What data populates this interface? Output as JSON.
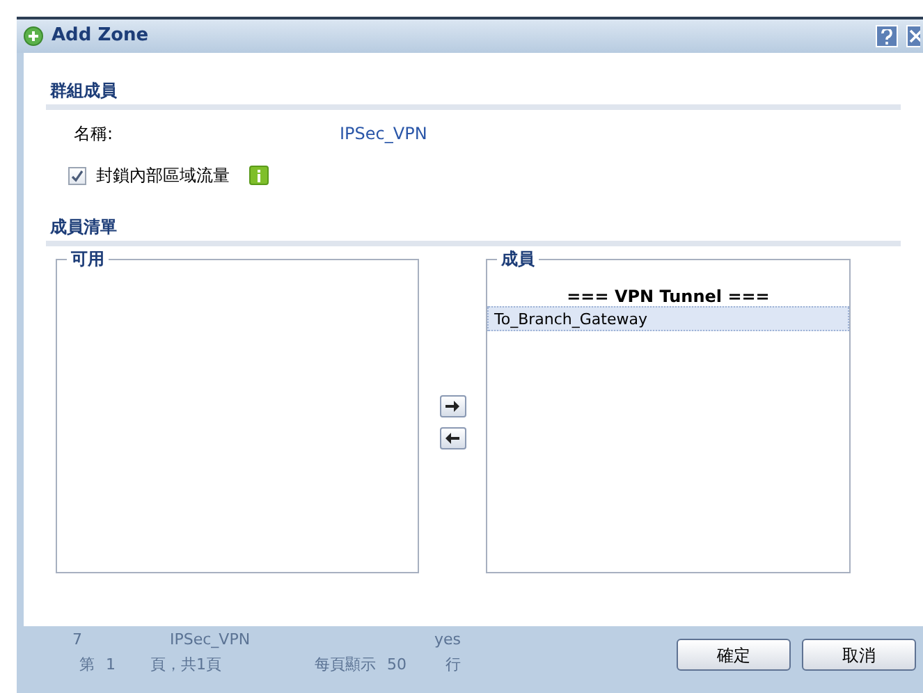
{
  "window": {
    "title": "Add Zone"
  },
  "group_section": {
    "title": "群組成員",
    "name_label": "名稱:",
    "name_value": "IPSec_VPN",
    "block_checkbox": {
      "label": "封鎖內部區域流量",
      "checked": true
    }
  },
  "member_section": {
    "title": "成員清單",
    "available": {
      "legend": "可用"
    },
    "members": {
      "legend": "成員",
      "group_header": "=== VPN Tunnel ===",
      "items": [
        {
          "label": "To_Branch_Gateway",
          "selected": true
        }
      ]
    }
  },
  "background_page": {
    "row": [
      "7",
      "IPSec_VPN",
      "yes"
    ],
    "pager": {
      "page_label": "第",
      "page_value": "1",
      "page_total": "頁，共1頁",
      "per_page_label": "每頁顯示",
      "per_page_value": "50",
      "rows_label": "行"
    }
  },
  "buttons": [
    {
      "label": "確定"
    },
    {
      "label": "取消"
    }
  ]
}
